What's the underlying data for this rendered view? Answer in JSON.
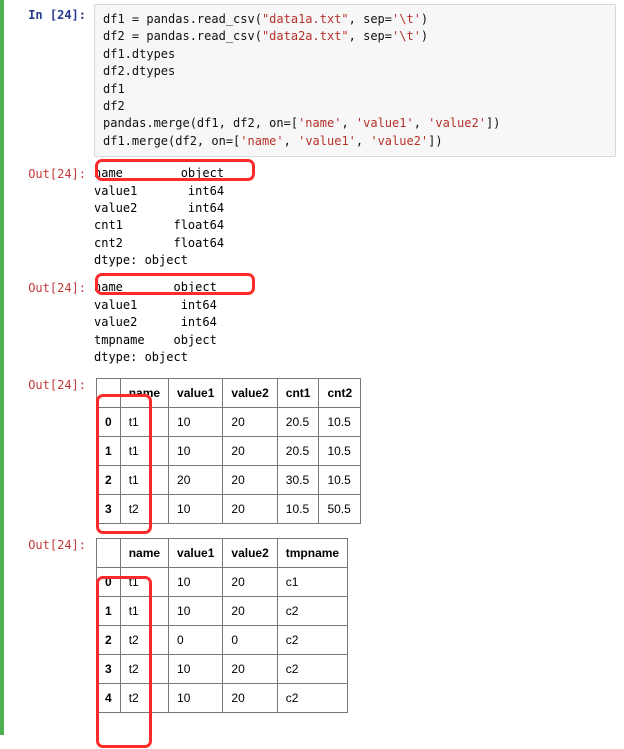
{
  "in_label": "In [24]:",
  "out_label": "Out[24]:",
  "code": {
    "l1a": "df1 = pandas.read_csv(",
    "l1b": "\"data1a.txt\"",
    "l1c": ", sep=",
    "l1d": "'\\t'",
    "l1e": ")",
    "l2a": "df2 = pandas.read_csv(",
    "l2b": "\"data2a.txt\"",
    "l2c": ", sep=",
    "l2d": "'\\t'",
    "l2e": ")",
    "l3": "df1.dtypes",
    "l4": "df2.dtypes",
    "l5": "df1",
    "l6": "df2",
    "l7a": "pandas.merge(df1, df2, on=[",
    "l7b": "'name'",
    "l7c": ", ",
    "l7d": "'value1'",
    "l7e": ", ",
    "l7f": "'value2'",
    "l7g": "])",
    "l8a": "df1.merge(df2, on=[",
    "l8b": "'name'",
    "l8c": ", ",
    "l8d": "'value1'",
    "l8e": ", ",
    "l8f": "'value2'",
    "l8g": "])"
  },
  "dtypes1": "name        object\nvalue1       int64\nvalue2       int64\ncnt1       float64\ncnt2       float64\ndtype: object",
  "dtypes2": "name       object\nvalue1      int64\nvalue2      int64\ntmpname    object\ndtype: object",
  "table1": {
    "columns": [
      "",
      "name",
      "value1",
      "value2",
      "cnt1",
      "cnt2"
    ],
    "rows": [
      [
        "0",
        "t1",
        "10",
        "20",
        "20.5",
        "10.5"
      ],
      [
        "1",
        "t1",
        "10",
        "20",
        "20.5",
        "10.5"
      ],
      [
        "2",
        "t1",
        "20",
        "20",
        "30.5",
        "10.5"
      ],
      [
        "3",
        "t2",
        "10",
        "20",
        "10.5",
        "50.5"
      ]
    ]
  },
  "table2": {
    "columns": [
      "",
      "name",
      "value1",
      "value2",
      "tmpname"
    ],
    "rows": [
      [
        "0",
        "t1",
        "10",
        "20",
        "c1"
      ],
      [
        "1",
        "t1",
        "10",
        "20",
        "c2"
      ],
      [
        "2",
        "t2",
        "0",
        "0",
        "c2"
      ],
      [
        "3",
        "t2",
        "10",
        "20",
        "c2"
      ],
      [
        "4",
        "t2",
        "10",
        "20",
        "c2"
      ]
    ]
  },
  "annotations": {
    "box1": "dtypes-name-object-highlight-1",
    "box2": "dtypes-name-object-highlight-2",
    "box3": "table1-index-column-highlight",
    "box4": "table2-index-column-highlight"
  }
}
